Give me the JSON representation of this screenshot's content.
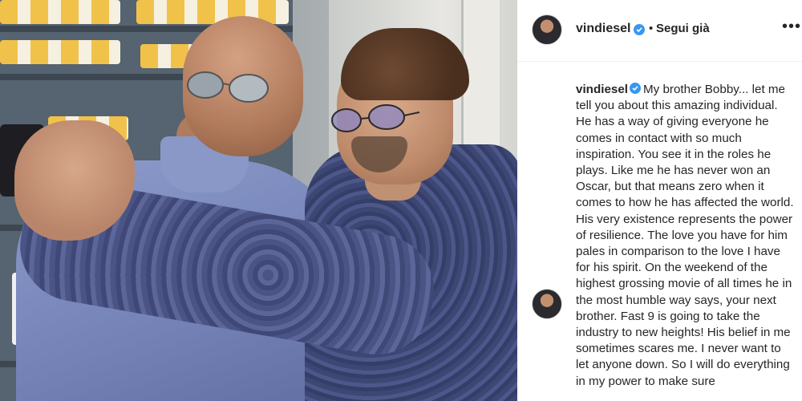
{
  "post": {
    "username": "vindiesel",
    "dot": "•",
    "follow_status": "Segui già",
    "more_label": "•••",
    "caption_user": "vindiesel",
    "caption_text": "My brother Bobby... let me tell you about this amazing individual. He has a way of giving everyone he comes in contact with so much inspiration. You see it in the roles he plays. Like me he has never won an Oscar, but that means zero when it comes to how he has affected the world. His very existence represents the power of resilience. The love you have for him pales in comparison to the love I have for his spirit. On the weekend of the highest grossing movie of all times he in the most humble way says, your next brother. Fast 9 is going to take the industry to new heights! His belief in me sometimes scares me. I never want to let anyone down. So I will do everything in my power to make sure"
  },
  "icons": {
    "verified": "verified-badge-icon",
    "more": "more-options-icon"
  },
  "colors": {
    "verified_blue": "#3897f0",
    "text": "#262626"
  }
}
